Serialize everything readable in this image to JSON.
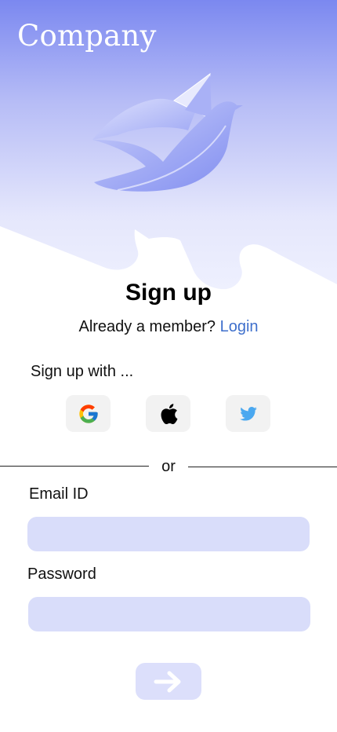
{
  "brand": {
    "name": "Company"
  },
  "page": {
    "title": "Sign up",
    "member_prompt": "Already a member?",
    "login_link": "Login"
  },
  "social": {
    "heading": "Sign up with ...",
    "providers": [
      {
        "name": "Google",
        "icon": "google-icon"
      },
      {
        "name": "Apple",
        "icon": "apple-icon"
      },
      {
        "name": "Twitter",
        "icon": "twitter-icon"
      }
    ]
  },
  "divider": {
    "label": "or"
  },
  "form": {
    "email_label": "Email ID",
    "email_value": "",
    "password_label": "Password",
    "password_value": "",
    "submit_icon": "arrow-right-icon"
  },
  "colors": {
    "hero_top": "#7b88f0",
    "hero_bottom": "#eceefd",
    "input_bg": "#d9ddfa",
    "link": "#3e6fcc",
    "social_bg": "#f2f2f2"
  }
}
